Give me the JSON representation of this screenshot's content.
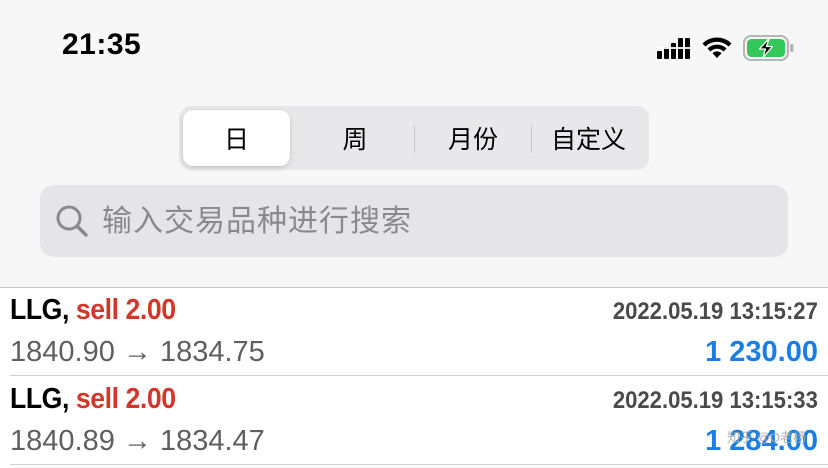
{
  "status_bar": {
    "time": "21:35"
  },
  "segmented_control": {
    "segments": [
      "日",
      "周",
      "月份",
      "自定义"
    ],
    "selected_index": 0
  },
  "search": {
    "placeholder": "输入交易品种进行搜索",
    "value": ""
  },
  "trades": [
    {
      "symbol": "LLG",
      "separator": ", ",
      "side_volume": "sell 2.00",
      "datetime": "2022.05.19 13:15:27",
      "prices": "1840.90 → 1834.75",
      "profit": "1 230.00"
    },
    {
      "symbol": "LLG",
      "separator": ", ",
      "side_volume": "sell 2.00",
      "datetime": "2022.05.19 13:15:33",
      "prices": "1840.89 → 1834.47",
      "profit": "1 284.00"
    }
  ],
  "watermark": "知乎 @Q老杨",
  "colors": {
    "sell": "#d1372a",
    "profit": "#1a7ee6",
    "battery": "#34c759"
  }
}
